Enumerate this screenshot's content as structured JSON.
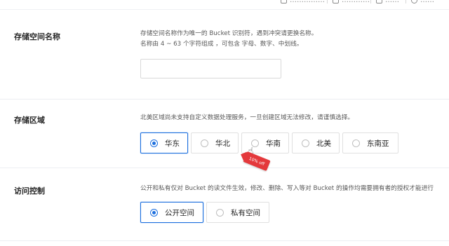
{
  "toolbar": {
    "items": [
      "……………",
      "…………",
      "……",
      "……"
    ]
  },
  "bucket_name": {
    "label": "存储空间名称",
    "desc_line1": "存储空间名称作为唯一的 Bucket 识别符，遇到冲突请更换名称。",
    "desc_line2": "名称由 4 ~ 63 个字符组成 ，可包含 字母、数字、中划线。",
    "value": "",
    "placeholder": ""
  },
  "region": {
    "label": "存储区域",
    "desc": "北美区域尚未支持自定义数据处理服务，一旦创建区域无法修改，请谨慎选择。",
    "options": [
      "华东",
      "华北",
      "华南",
      "北美",
      "东南亚"
    ],
    "selected": "华东"
  },
  "promo_tag": {
    "text": "10% off",
    "color": "#e4393c"
  },
  "access": {
    "label": "访问控制",
    "desc": "公开和私有仅对 Bucket 的读文件生效，修改、删除、写入等对 Bucket 的操作均需要拥有者的授权才能进行",
    "options": [
      "公开空间",
      "私有空间"
    ],
    "selected": "公开空间"
  },
  "colors": {
    "accent": "#1d6fde",
    "border": "#e0e0e0"
  }
}
